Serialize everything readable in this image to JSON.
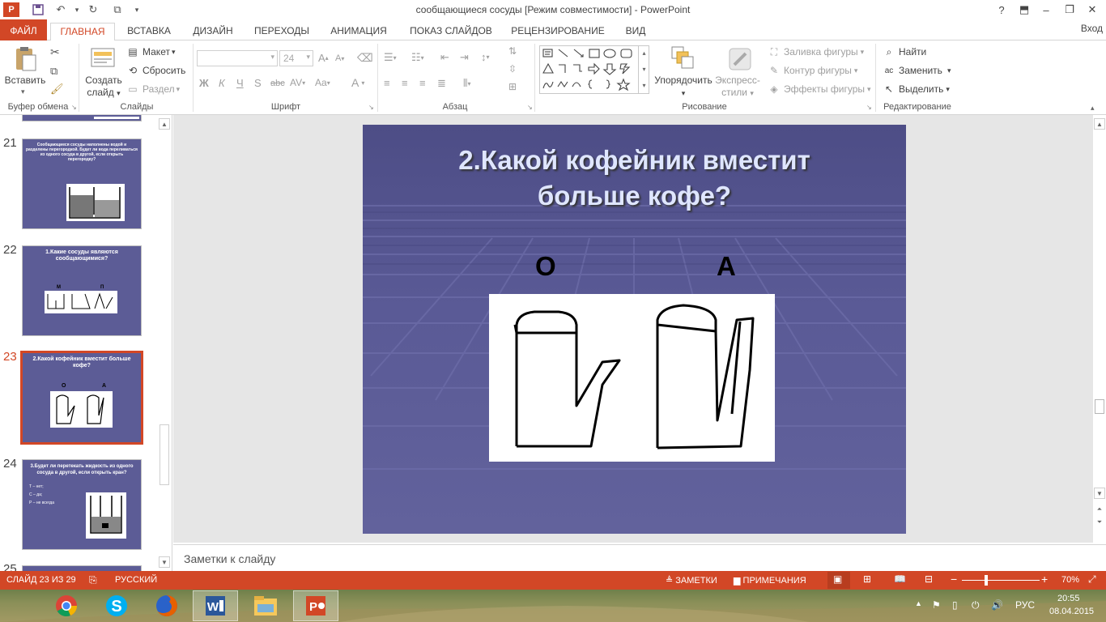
{
  "window": {
    "title": "сообщающиеся сосуды [Режим совместимости] - PowerPoint",
    "help": "?",
    "minimize": "‒",
    "restore": "❐",
    "close": "✕"
  },
  "tabs": {
    "file": "ФАЙЛ",
    "home": "ГЛАВНАЯ",
    "insert": "ВСТАВКА",
    "design": "ДИЗАЙН",
    "transitions": "ПЕРЕХОДЫ",
    "animation": "АНИМАЦИЯ",
    "slideshow": "ПОКАЗ СЛАЙДОВ",
    "review": "РЕЦЕНЗИРОВАНИЕ",
    "view": "ВИД",
    "signin": "Вход"
  },
  "ribbon": {
    "clipboard": {
      "label": "Буфер обмена",
      "paste": "Вставить"
    },
    "slides": {
      "label": "Слайды",
      "new_slide_1": "Создать",
      "new_slide_2": "слайд",
      "layout": "Макет",
      "reset": "Сбросить",
      "section": "Раздел"
    },
    "font": {
      "label": "Шрифт",
      "size": "24",
      "bold": "Ж",
      "italic": "К",
      "underline": "Ч",
      "shadow": "S",
      "strike": "abc",
      "spacing": "AV",
      "case": "Aa",
      "grow": "A",
      "shrink": "A",
      "color": "A"
    },
    "paragraph": {
      "label": "Абзац"
    },
    "drawing": {
      "label": "Рисование",
      "arrange": "Упорядочить",
      "quick_styles_1": "Экспресс-",
      "quick_styles_2": "стили",
      "fill": "Заливка фигуры",
      "outline": "Контур фигуры",
      "effects": "Эффекты фигуры"
    },
    "editing": {
      "label": "Редактирование",
      "find": "Найти",
      "replace": "Заменить",
      "select": "Выделить"
    }
  },
  "thumbnails": [
    {
      "num": "21",
      "title": "Сообщающиеся сосуды наполнены водой и разделены перегородкой. Будет ли вода переливаться из одного сосуда в другой, если открыть перегородку?"
    },
    {
      "num": "22",
      "title": "1.Какие сосуды являются сообщающимися?",
      "left_label": "М",
      "right_label": "П"
    },
    {
      "num": "23",
      "title": "2.Какой кофейник вместит больше кофе?",
      "left_label": "О",
      "right_label": "А"
    },
    {
      "num": "24",
      "title": "3.Будет ли перетекать жидкость из одного сосуда в другой, если открыть кран?",
      "bullets": [
        "Т – нет;",
        "С – да;",
        "Р – не всегда"
      ]
    },
    {
      "num": "25"
    }
  ],
  "slide": {
    "title_line1": "2.Какой кофейник вместит",
    "title_line2": "больше кофе?",
    "label_left": "О",
    "label_right": "А"
  },
  "notes": {
    "placeholder": "Заметки к слайду"
  },
  "status": {
    "slide_info": "СЛАЙД 23 ИЗ 29",
    "language": "РУССКИЙ",
    "notes": "ЗАМЕТКИ",
    "comments": "ПРИМЕЧАНИЯ",
    "zoom": "70%"
  },
  "taskbar": {
    "language": "РУС",
    "time": "20:55",
    "date": "08.04.2015"
  }
}
